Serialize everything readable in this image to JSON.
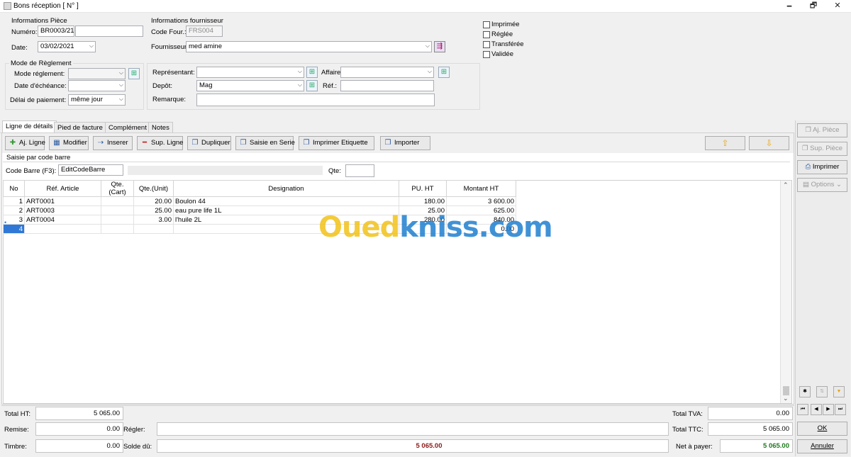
{
  "window": {
    "title": "Bons réception [ N° ]",
    "minimize": "🗕",
    "maximize": "🗗",
    "close": "✕"
  },
  "piece": {
    "group_title": "Informations Pièce",
    "numero_label": "Numéro:",
    "numero": "BR0003/21",
    "date_label": "Date:",
    "date": "03/02/2021"
  },
  "fournisseur": {
    "group_title": "Informations fournisseur",
    "code_label": "Code Four.:",
    "code": "FRS004",
    "name_label": "Fournisseur:",
    "name": "med amine"
  },
  "status_checks": [
    "Imprimée",
    "Réglée",
    "Transférée",
    "Validée"
  ],
  "reglement": {
    "group_title": "Mode de Règlement",
    "mode_label": "Mode réglement:",
    "mode": "",
    "echeance_label": "Date d'échéance:",
    "echeance": "",
    "delai_label": "Délai de paiement:",
    "delai": "même jour"
  },
  "other": {
    "representant_label": "Représentant:",
    "representant": "",
    "affaire_label": "Affaire",
    "affaire": "",
    "depot_label": "Depôt:",
    "depot": "Mag",
    "ref_label": "Réf.:",
    "ref": "",
    "remarque_label": "Remarque:",
    "remarque": ""
  },
  "tabs": [
    "Ligne de détails",
    "Pied de facture",
    "Complément",
    "Notes"
  ],
  "toolbar": {
    "aj_ligne": "Aj. Ligne",
    "modifier": "Modifier",
    "inserer": "Inserer",
    "sup_ligne": "Sup. Ligne",
    "dupliquer": "Dupliquer",
    "saisie_serie": "Saisie en Serie",
    "imprimer_etiquette": "Imprimer Etiquette",
    "importer": "Importer"
  },
  "barcode": {
    "section_title": "Saisie par code barre",
    "label": "Code Barre (F3):",
    "value": "EditCodeBarre",
    "qte_label": "Qte:",
    "qte": ""
  },
  "grid": {
    "columns": [
      "No",
      "Réf. Article",
      "Qte.(Cart)",
      "Qte.(Unit)",
      "Designation",
      "PU. HT",
      "Montant HT"
    ],
    "rows": [
      [
        "1",
        "ART0001",
        "",
        "20.00",
        "Boulon 44",
        "180.00",
        "3 600.00"
      ],
      [
        "2",
        "ART0003",
        "",
        "25.00",
        "eau  pure life 1L",
        "25.00",
        "625.00"
      ],
      [
        "3",
        "ART0004",
        "",
        "3.00",
        "l'huile 2L",
        "280.00",
        "840.00"
      ],
      [
        "4",
        "",
        "",
        "",
        "",
        "",
        "0.00"
      ]
    ]
  },
  "watermark": "Ouedkniss.com",
  "side": {
    "aj_piece": "Aj. Pièce",
    "sup_piece": "Sup. Pièce",
    "imprimer": "Imprimer",
    "options": "Options",
    "ok": "OK",
    "annuler": "Annuler"
  },
  "totals": {
    "total_ht_label": "Total HT:",
    "total_ht": "5 065.00",
    "remise_label": "Remise:",
    "remise": "0.00",
    "timbre_label": "Timbre:",
    "timbre": "0.00",
    "regler_label": "Régler:",
    "regler": "",
    "solde_label": "Solde dû:",
    "solde": "5 065.00",
    "total_tva_label": "Total TVA:",
    "total_tva": "0.00",
    "total_ttc_label": "Total TTC:",
    "total_ttc": "5 065.00",
    "net_label": "Net à payer:",
    "net": "5 065.00"
  },
  "colors": {
    "solde": "#8b1a1a",
    "net": "#1f7a1f",
    "watermark_blue": "#1f7fd0",
    "watermark_yellow": "#f2c21a"
  }
}
